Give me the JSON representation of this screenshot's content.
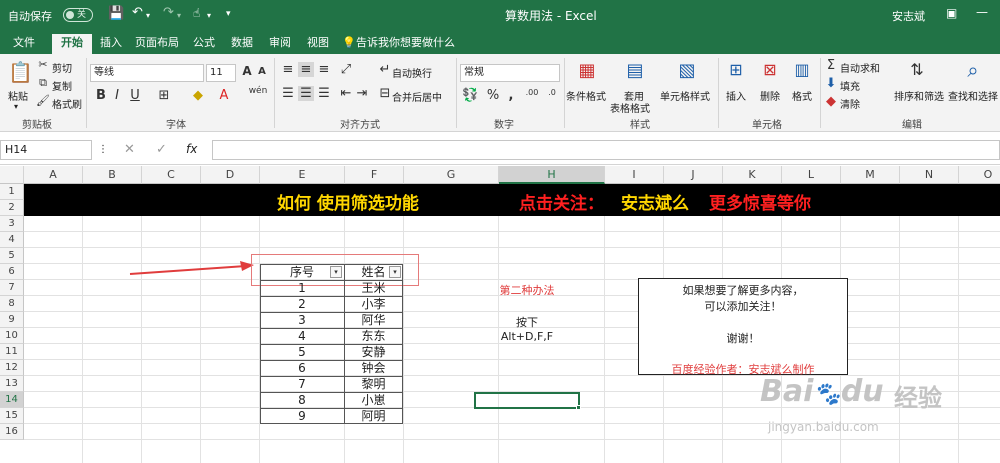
{
  "titlebar": {
    "autosave_label": "自动保存",
    "autosave_state": "关",
    "title": "算数用法  -  Excel",
    "user": "安志斌"
  },
  "menu": {
    "tabs": [
      "文件",
      "开始",
      "插入",
      "页面布局",
      "公式",
      "数据",
      "审阅",
      "视图"
    ],
    "active": "开始",
    "tell_me": "告诉我你想要做什么"
  },
  "ribbon": {
    "clipboard": {
      "paste": "粘贴",
      "cut": "剪切",
      "copy": "复制",
      "format_painter": "格式刷",
      "group": "剪贴板"
    },
    "font": {
      "name": "等线",
      "size": "11",
      "group": "字体"
    },
    "alignment": {
      "wrap": "自动换行",
      "merge": "合并后居中",
      "group": "对齐方式"
    },
    "number": {
      "format": "常规",
      "group": "数字"
    },
    "styles": {
      "conditional": "条件格式",
      "table": "套用\n表格格式",
      "cell": "单元格样式",
      "group": "样式"
    },
    "cells": {
      "insert": "插入",
      "delete": "删除",
      "format": "格式",
      "group": "单元格"
    },
    "editing": {
      "autosum": "自动求和",
      "fill": "填充",
      "clear": "清除",
      "sort": "排序和筛选",
      "find": "查找和选择",
      "group": "编辑"
    }
  },
  "formula": {
    "name_box": "H14",
    "fx": "fx"
  },
  "columns": [
    "A",
    "B",
    "C",
    "D",
    "E",
    "F",
    "G",
    "H",
    "I",
    "J",
    "K",
    "L",
    "M",
    "N",
    "O"
  ],
  "rows": [
    "1",
    "2",
    "3",
    "4",
    "5",
    "6",
    "7",
    "8",
    "9",
    "10",
    "11",
    "12",
    "13",
    "14",
    "15",
    "16"
  ],
  "banner": {
    "part1": "如何 使用筛选功能",
    "part2": "点击关注：",
    "part3": "安志斌么",
    "part4": "更多惊喜等你"
  },
  "table": {
    "headers": [
      "序号",
      "姓名"
    ],
    "rows": [
      [
        "1",
        "王米"
      ],
      [
        "2",
        "小李"
      ],
      [
        "3",
        "阿华"
      ],
      [
        "4",
        "东东"
      ],
      [
        "5",
        "安静"
      ],
      [
        "6",
        "钟会"
      ],
      [
        "7",
        "黎明"
      ],
      [
        "8",
        "小崽"
      ],
      [
        "9",
        "阿明"
      ]
    ]
  },
  "method": {
    "title": "第二种办法",
    "press": "按下",
    "keys": "Alt+D,F,F"
  },
  "info": {
    "line1": "如果想要了解更多内容，",
    "line2": "可以添加关注！",
    "line3": "谢谢！",
    "line4": "百度经验作者：安志斌么制作"
  },
  "watermark": {
    "logo": "Bai",
    "logo2": "du",
    "brand": "经验",
    "url": "jingyan.baidu.com"
  },
  "colors": {
    "excel_green": "#217346",
    "banner_yellow": "#ffd700",
    "banner_red": "#ff2020",
    "accent_red": "#e03c3c"
  }
}
